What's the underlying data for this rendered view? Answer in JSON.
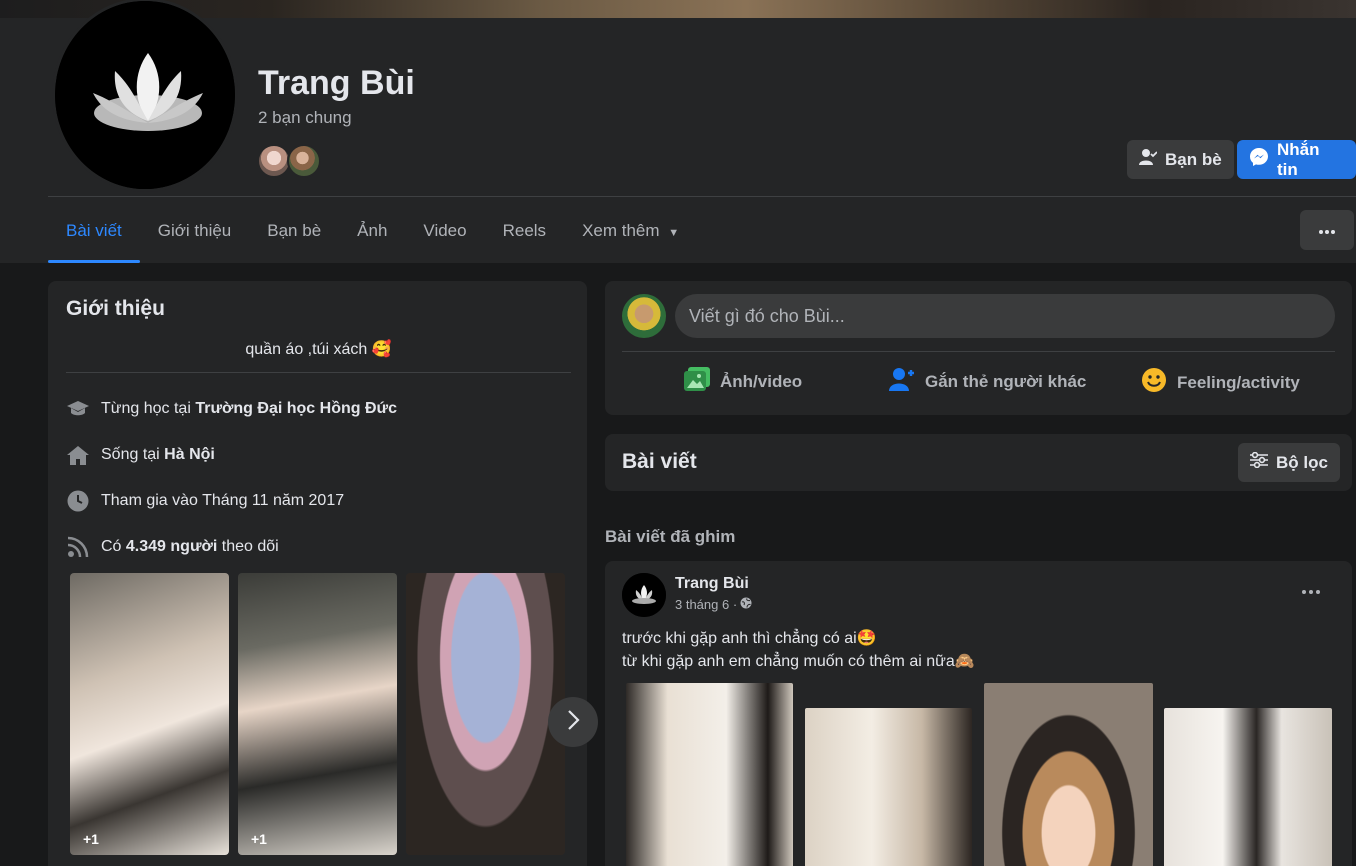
{
  "profile": {
    "name": "Trang Bùi",
    "mutual_friends": "2 bạn chung",
    "friends_button": "Bạn bè",
    "message_button": "Nhắn tin"
  },
  "tabs": [
    "Bài viết",
    "Giới thiệu",
    "Bạn bè",
    "Ảnh",
    "Video",
    "Reels",
    "Xem thêm"
  ],
  "intro": {
    "title": "Giới thiệu",
    "bio": "quần áo ,túi xách 🥰",
    "studied_prefix": "Từng học tại",
    "studied_value": "Trường Đại học Hồng Đức",
    "lives_prefix": "Sống tại",
    "lives_value": "Hà Nội",
    "joined": "Tham gia vào Tháng 11 năm 2017",
    "followers_prefix": "Có",
    "followers_value": "4.349 người",
    "followers_suffix": "theo dõi",
    "photo_badges": [
      "+1",
      "+1"
    ]
  },
  "composer": {
    "placeholder": "Viết gì đó cho Bùi...",
    "actions": [
      "Ảnh/video",
      "Gắn thẻ người khác",
      "Feeling/activity"
    ]
  },
  "posts": {
    "title": "Bài viết",
    "filter_label": "Bộ lọc",
    "pinned_label": "Bài viết đã ghim"
  },
  "post": {
    "author": "Trang Bùi",
    "time": "3 tháng 6 ·",
    "line1": "trước khi gặp anh thì chẳng có ai🤩",
    "line2": "từ khi gặp anh em chẳng muốn có thêm ai nữa🙈"
  },
  "colors": {
    "accent": "#2d88ff",
    "message_button": "#2374e1",
    "background": "#18191a",
    "card": "#242526"
  }
}
